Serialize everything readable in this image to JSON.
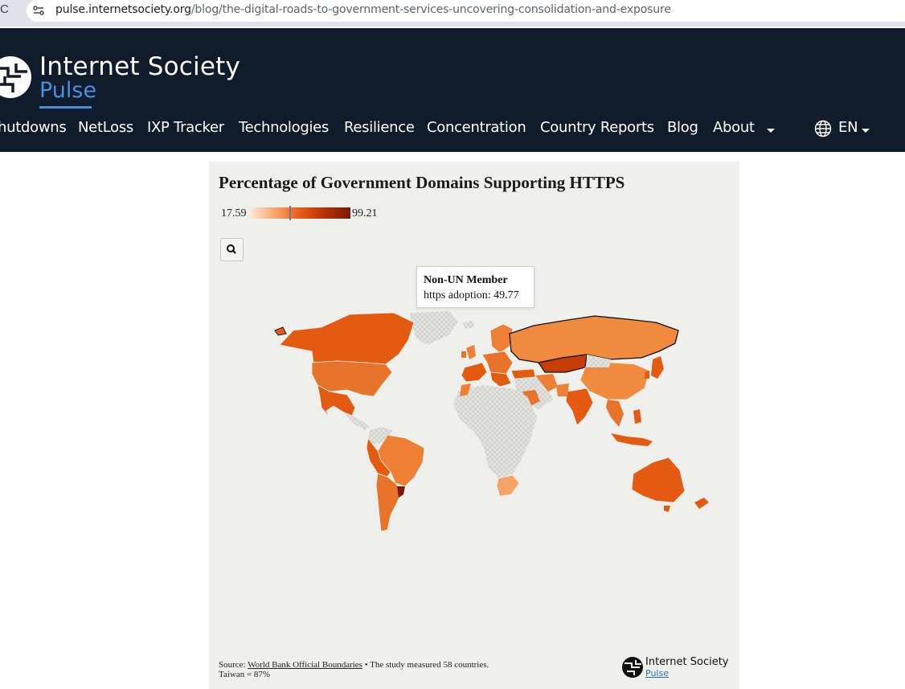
{
  "browser": {
    "url_host": "pulse.internetsociety.org",
    "url_path": "/blog/the-digital-roads-to-government-services-uncovering-consolidation-and-exposure"
  },
  "site": {
    "brand": "Internet Society",
    "sub_brand": "Pulse",
    "nav": [
      {
        "label": "hutdowns"
      },
      {
        "label": "NetLoss"
      },
      {
        "label": "IXP Tracker"
      },
      {
        "label": "Technologies"
      },
      {
        "label": "Resilience"
      },
      {
        "label": "Concentration"
      },
      {
        "label": "Country Reports"
      },
      {
        "label": "Blog"
      },
      {
        "label": "About"
      }
    ],
    "language": "EN"
  },
  "chart": {
    "title": "Percentage of Government Domains Supporting HTTPS",
    "legend_min": "17.59",
    "legend_max": "99.21",
    "tooltip_title": "Non-UN Member",
    "tooltip_text": "https adoption: 49.77",
    "source_label": "Source: ",
    "source_link": "World Bank Official Boundaries",
    "source_note": " • The study measured 58 countries.",
    "source_note2": "Taiwan = 87%",
    "footer_brand": "Internet Society",
    "footer_sub": "Pulse"
  },
  "colors": {
    "header_bg": "#101c2b",
    "accent_blue": "#4a8fe0",
    "map_low": "#fde7d4",
    "map_mid": "#f08a3e",
    "map_high": "#e35a10",
    "map_darkest": "#7a1a02",
    "no_data": "#d9d9d6"
  }
}
